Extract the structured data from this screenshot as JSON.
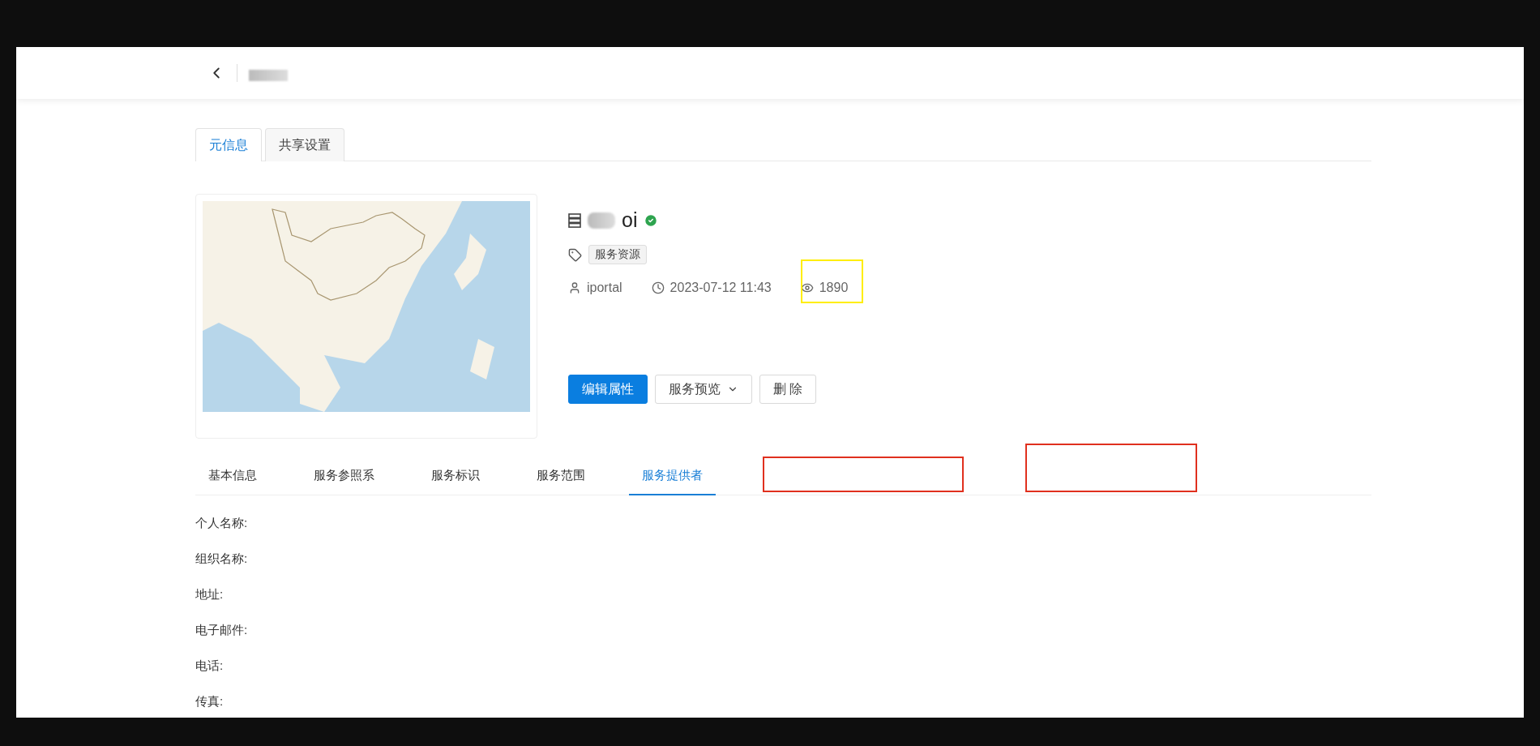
{
  "resource_tabs": [
    {
      "label": "元信息",
      "selected": true
    },
    {
      "label": "共享设置",
      "selected": false
    }
  ],
  "resource": {
    "title": "oi",
    "verified": true,
    "tag": "服务资源",
    "owner": "iportal",
    "time": "2023-07-12 11:43",
    "views": "1890"
  },
  "actions": [
    {
      "kind": "primary",
      "label": "编辑属性"
    },
    {
      "kind": "dropdown",
      "label": "服务预览"
    },
    {
      "kind": "default",
      "label": "删 除"
    }
  ],
  "detail_tabs": [
    {
      "label": "基本信息",
      "selected": false
    },
    {
      "label": "服务参照系",
      "selected": false
    },
    {
      "label": "服务标识",
      "selected": false
    },
    {
      "label": "服务范围",
      "selected": false
    },
    {
      "label": "服务提供者",
      "selected": true
    }
  ],
  "fields": [
    {
      "label": "个人名称:"
    },
    {
      "label": "组织名称:"
    },
    {
      "label": "地址:"
    },
    {
      "label": "电子邮件:"
    },
    {
      "label": "电话:"
    },
    {
      "label": "传真:"
    }
  ],
  "annotations": [
    {
      "color": "#ffee00"
    },
    {
      "color": "#e0301e"
    },
    {
      "color": "#e0301e"
    }
  ]
}
